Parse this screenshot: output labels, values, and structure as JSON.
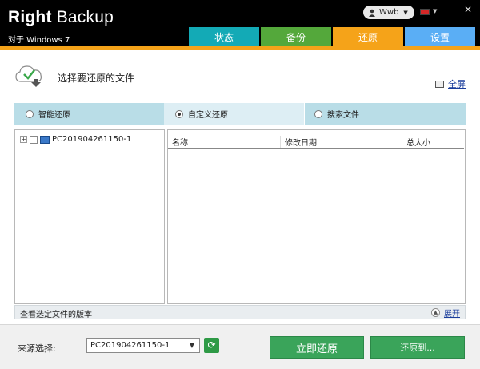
{
  "app": {
    "title_bold": "Right",
    "title_rest": "Backup",
    "subtitle": "对于 Windows 7"
  },
  "topbar": {
    "user": "Wwb",
    "minimize": "–",
    "close": "✕"
  },
  "tabs": [
    {
      "label": "状态"
    },
    {
      "label": "备份"
    },
    {
      "label": "还原"
    },
    {
      "label": "设置"
    }
  ],
  "section": {
    "title": "选择要还原的文件",
    "fullscreen_label": "全屏"
  },
  "modes": [
    {
      "label": "智能还原",
      "selected": false
    },
    {
      "label": "自定义还原",
      "selected": true
    },
    {
      "label": "搜索文件",
      "selected": false
    }
  ],
  "tree": {
    "expander": "+",
    "root_label": "PC201904261150-1"
  },
  "file_list": {
    "columns": [
      "名称",
      "修改日期",
      "总大小"
    ],
    "rows": []
  },
  "version_bar": {
    "label": "查看选定文件的版本",
    "expand_label": "展开"
  },
  "footer": {
    "source_label": "来源选择:",
    "source_value": "PC201904261150-1",
    "restore_now": "立即还原",
    "restore_to": "还原到..."
  },
  "colors": {
    "tab_status": "#13aab6",
    "tab_backup": "#54a83b",
    "tab_restore": "#f5a319",
    "tab_settings": "#5aaef5",
    "accent_green": "#3aa45a"
  }
}
